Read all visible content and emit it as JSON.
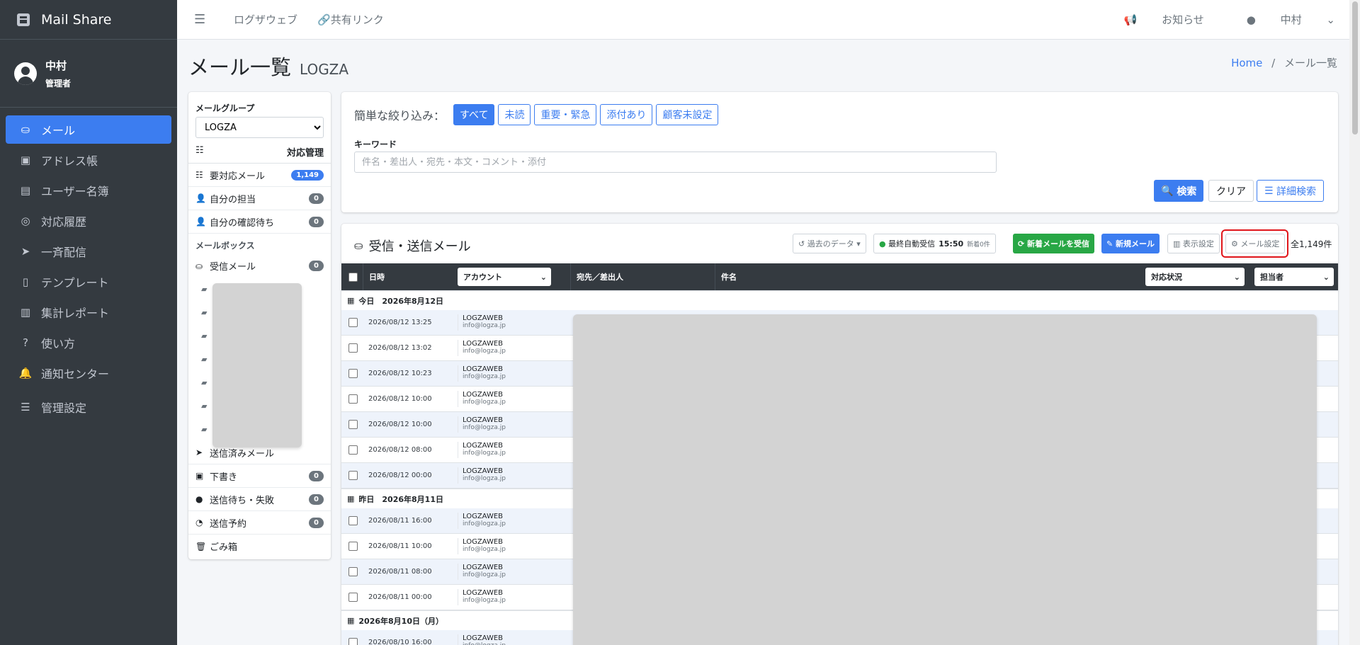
{
  "brand": "Mail Share",
  "user": {
    "name": "中村",
    "role": "管理者"
  },
  "nav": [
    {
      "label": "メール",
      "icon": "inbox-icon",
      "glyph": "⛀",
      "active": true
    },
    {
      "label": "アドレス帳",
      "icon": "address-book-icon",
      "glyph": "▣"
    },
    {
      "label": "ユーザー名簿",
      "icon": "id-card-icon",
      "glyph": "▤"
    },
    {
      "label": "対応履歴",
      "icon": "headset-icon",
      "glyph": "◎"
    },
    {
      "label": "一斉配信",
      "icon": "paper-plane-icon",
      "glyph": "➤"
    },
    {
      "label": "テンプレート",
      "icon": "file-icon",
      "glyph": "▯"
    },
    {
      "label": "集計レポート",
      "icon": "chart-icon",
      "glyph": "▥"
    },
    {
      "label": "使い方",
      "icon": "question-icon",
      "glyph": "?"
    },
    {
      "label": "通知センター",
      "icon": "bell-icon",
      "glyph": "🔔"
    },
    {
      "label": "管理設定",
      "icon": "sliders-icon",
      "glyph": "☰"
    }
  ],
  "topbar": {
    "link1": "ログザウェブ",
    "link2": "共有リンク",
    "notice": "お知らせ",
    "user": "中村"
  },
  "page": {
    "title": "メール一覧",
    "subtitle": "LOGZA",
    "breadcrumb_home": "Home",
    "breadcrumb_sep": "/",
    "breadcrumb_current": "メール一覧"
  },
  "left": {
    "group_label": "メールグループ",
    "group_selected": "LOGZA",
    "manage_label": "対応管理",
    "items": [
      {
        "label": "要対応メール",
        "count": "1,149"
      },
      {
        "label": "自分の担当",
        "count": "0"
      },
      {
        "label": "自分の確認待ち",
        "count": "0"
      }
    ],
    "mailbox_label": "メールボックス",
    "inbox": {
      "label": "受信メール",
      "count": "0"
    },
    "sent": {
      "label": "送信済みメール"
    },
    "drafts": {
      "label": "下書き",
      "count": "0"
    },
    "failed": {
      "label": "送信待ち・失敗",
      "count": "0"
    },
    "scheduled": {
      "label": "送信予約",
      "count": "0"
    },
    "trash": {
      "label": "ごみ箱"
    }
  },
  "filter": {
    "label": "簡単な絞り込み：",
    "buttons": [
      "すべて",
      "未読",
      "重要・緊急",
      "添付あり",
      "顧客未設定"
    ],
    "keyword_label": "キーワード",
    "keyword_placeholder": "件名・差出人・宛先・本文・コメント・添付",
    "search": "検索",
    "clear": "クリア",
    "advanced": "詳細検索"
  },
  "mail": {
    "title": "受信・送信メール",
    "past_data": "過去のデータ",
    "auto_label": "最終自動受信",
    "auto_time": "15:50",
    "auto_new": "新着0件",
    "fetch": "新着メールを受信",
    "new_mail": "新規メール",
    "display": "表示設定",
    "mail_settings": "メール設定",
    "total": "全1,149件",
    "columns": {
      "date": "日時",
      "account": "アカウント",
      "to_from": "宛先／差出人",
      "subject": "件名",
      "status": "対応状況",
      "assignee": "担当者"
    },
    "groups": [
      {
        "label": "今日　2026年8月12日",
        "rows": [
          {
            "date": "2026/08/12 13:25",
            "account": "LOGZAWEB",
            "mail": "info@logza.jp"
          },
          {
            "date": "2026/08/12 13:02",
            "account": "LOGZAWEB",
            "mail": "info@logza.jp"
          },
          {
            "date": "2026/08/12 10:23",
            "account": "LOGZAWEB",
            "mail": "info@logza.jp"
          },
          {
            "date": "2026/08/12 10:00",
            "account": "LOGZAWEB",
            "mail": "info@logza.jp"
          },
          {
            "date": "2026/08/12 10:00",
            "account": "LOGZAWEB",
            "mail": "info@logza.jp"
          },
          {
            "date": "2026/08/12 08:00",
            "account": "LOGZAWEB",
            "mail": "info@logza.jp"
          },
          {
            "date": "2026/08/12 00:00",
            "account": "LOGZAWEB",
            "mail": "info@logza.jp"
          }
        ]
      },
      {
        "label": "昨日　2026年8月11日",
        "rows": [
          {
            "date": "2026/08/11 16:00",
            "account": "LOGZAWEB",
            "mail": "info@logza.jp"
          },
          {
            "date": "2026/08/11 10:00",
            "account": "LOGZAWEB",
            "mail": "info@logza.jp"
          },
          {
            "date": "2026/08/11 08:00",
            "account": "LOGZAWEB",
            "mail": "info@logza.jp"
          },
          {
            "date": "2026/08/11 00:00",
            "account": "LOGZAWEB",
            "mail": "info@logza.jp"
          }
        ]
      },
      {
        "label": "2026年8月10日（月）",
        "rows": [
          {
            "date": "2026/08/10 16:00",
            "account": "LOGZAWEB",
            "mail": "info@logza.jp"
          }
        ]
      }
    ]
  },
  "colors": {
    "primary": "#3c7df0",
    "sidebar": "#343a40",
    "success": "#28a745",
    "highlight": "#e0161b"
  }
}
